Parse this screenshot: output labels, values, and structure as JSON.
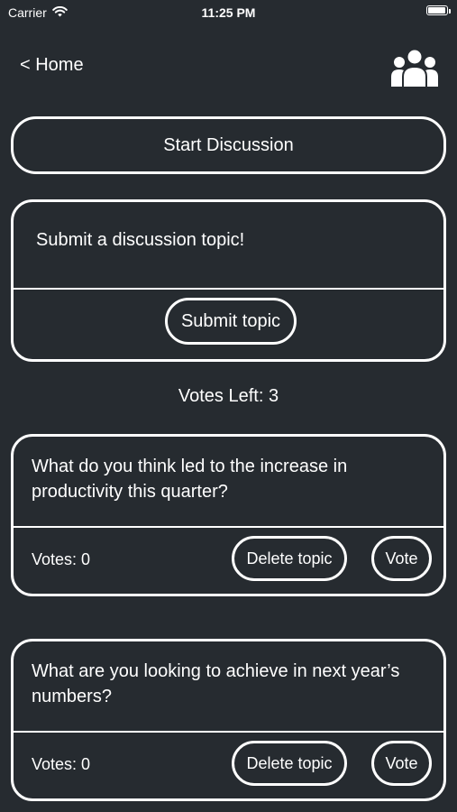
{
  "status_bar": {
    "carrier": "Carrier",
    "time": "11:25 PM",
    "battery_level": 0.95,
    "wifi_icon": "wifi-icon",
    "battery_icon": "battery-icon"
  },
  "nav": {
    "back_label": "< Home",
    "people_icon": "people-group-icon"
  },
  "start_discussion_label": "Start Discussion",
  "submit_section": {
    "placeholder": "Submit a discussion topic!",
    "button_label": "Submit topic"
  },
  "votes_left": "Votes Left: 3",
  "topics": [
    {
      "text": "What do you think led to the increase in productivity this quarter?",
      "votes_label": "Votes: 0",
      "delete_label": "Delete topic",
      "vote_label": "Vote"
    },
    {
      "text": "What are you looking to achieve in next year’s numbers?",
      "votes_label": "Votes: 0",
      "delete_label": "Delete topic",
      "vote_label": "Vote"
    }
  ],
  "colors": {
    "background": "#262b30",
    "foreground": "#ffffff"
  }
}
